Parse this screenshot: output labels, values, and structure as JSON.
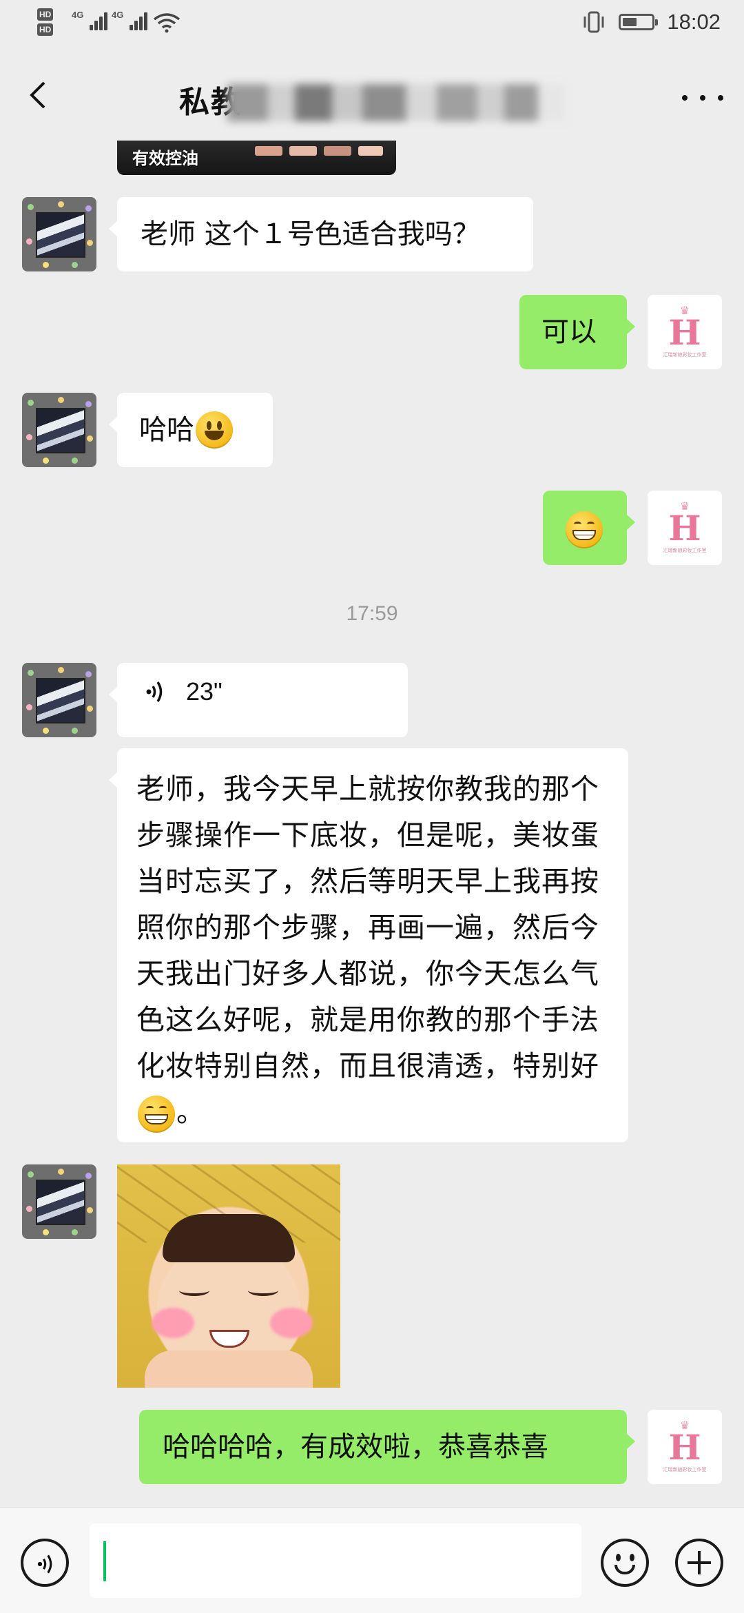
{
  "status_bar": {
    "network_1": "4G",
    "network_2": "4G",
    "hd_1": "HD",
    "hd_2": "HD",
    "battery_level": 0.5,
    "time": "18:02"
  },
  "header": {
    "title_visible": "私教",
    "title_obscured": true,
    "back_icon": "chevron-left-icon",
    "more_icon": "more-dots-icon"
  },
  "messages": {
    "top_image_caption": "有效控油",
    "msg1": "老师 这个１号色适合我吗？",
    "msg2": "可以",
    "msg3_text": "哈哈",
    "msg3_emoji": "smile-emoji",
    "msg4_emoji": "grin-emoji",
    "timestamp": "17:59",
    "voice_duration": "23\"",
    "long_text_before_emoji": "老师，我今天早上就按你教我的那个步骤操作一下底妆，但是呢，美妆蛋当时忘买了，然后等明天早上我再按照你的那个步骤，再画一遍，然后今天我出门好多人都说，你今天怎么气色这么好呢，就是用你教的那个手法化妆特别自然，而且很清透，特别好",
    "long_text_after_emoji": "。",
    "sticker": "baby-smile-sticker",
    "last_msg": "哈哈哈哈，有成效啦，恭喜恭喜"
  },
  "right_avatar": {
    "letter": "H",
    "caption": "汇瑞新娘彩妆工作室"
  },
  "colors": {
    "background": "#ededed",
    "self_bubble": "#95ec69",
    "other_bubble": "#ffffff",
    "caret": "#07c160",
    "avatar_pink": "#e8779a"
  },
  "input_bar": {
    "value": "",
    "voice_icon": "voice-icon",
    "emoji_icon": "emoji-icon",
    "plus_icon": "plus-icon"
  }
}
